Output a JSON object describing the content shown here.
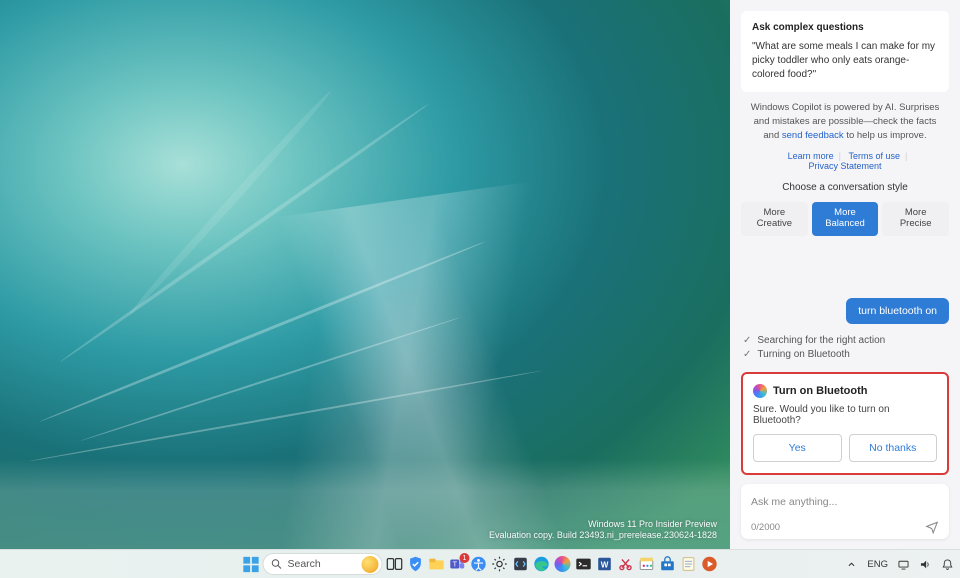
{
  "watermark": {
    "line1": "Windows 11 Pro Insider Preview",
    "line2": "Evaluation copy. Build 23493.ni_prerelease.230624-1828"
  },
  "copilot": {
    "suggestion": {
      "title": "Ask complex questions",
      "body": "\"What are some meals I can make for my picky toddler who only eats orange-colored food?\""
    },
    "disclaimer": {
      "text_before": "Windows Copilot is powered by AI. Surprises and mistakes are possible—check the facts and ",
      "link": "send feedback",
      "text_after": " to help us improve."
    },
    "links": {
      "learn": "Learn more",
      "terms": "Terms of use",
      "privacy": "Privacy Statement"
    },
    "style_label": "Choose a conversation style",
    "styles": {
      "creative": "More\nCreative",
      "balanced": "More\nBalanced",
      "precise": "More\nPrecise"
    },
    "user_message": "turn bluetooth on",
    "status": {
      "s1": "Searching for the right action",
      "s2": "Turning on Bluetooth"
    },
    "confirm": {
      "title": "Turn on Bluetooth",
      "body": "Sure. Would you like to turn on Bluetooth?",
      "yes": "Yes",
      "no": "No thanks"
    },
    "input": {
      "placeholder": "Ask me anything...",
      "counter": "0/2000"
    }
  },
  "taskbar": {
    "search_placeholder": "Search",
    "lang": "ENG",
    "teams_badge": "1"
  }
}
